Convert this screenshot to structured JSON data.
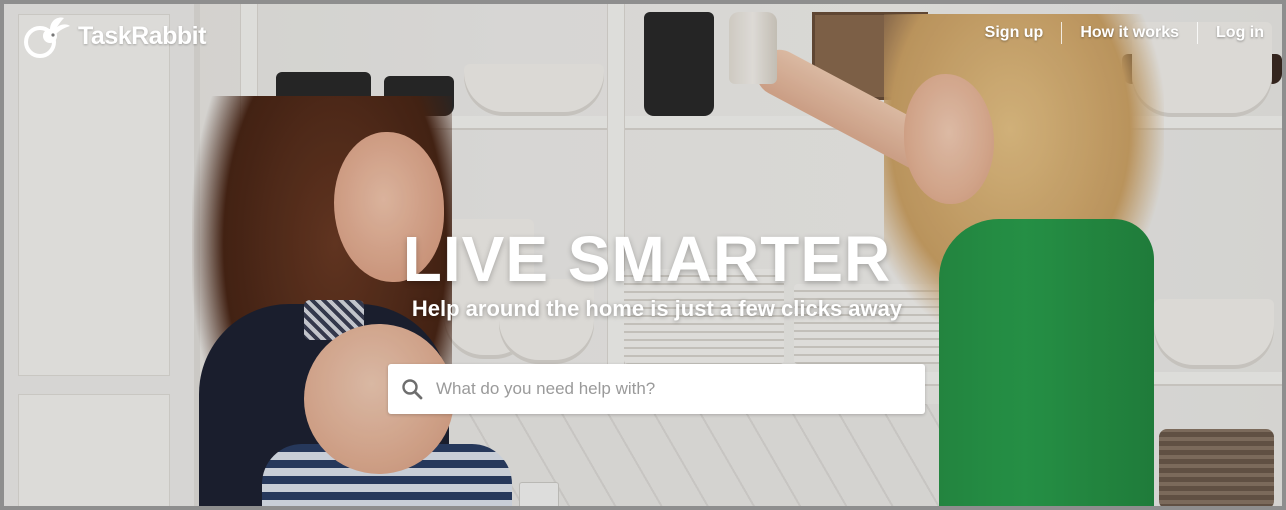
{
  "brand": {
    "name": "TaskRabbit",
    "logo_icon": "rabbit-logo-icon"
  },
  "nav": {
    "items": [
      {
        "label": "Sign up"
      },
      {
        "label": "How it works"
      },
      {
        "label": "Log in"
      }
    ]
  },
  "hero": {
    "title": "LIVE SMARTER",
    "subtitle": "Help around the home is just a few clicks away",
    "background": "photo-two-women-and-baby-in-kitchen"
  },
  "search": {
    "icon": "search-icon",
    "placeholder": "What do you need help with?",
    "value": ""
  },
  "colors": {
    "text_on_hero": "#ffffff",
    "search_bg": "#ffffff",
    "placeholder": "#9a9a9a",
    "shirt_green": "#2aa04d"
  }
}
